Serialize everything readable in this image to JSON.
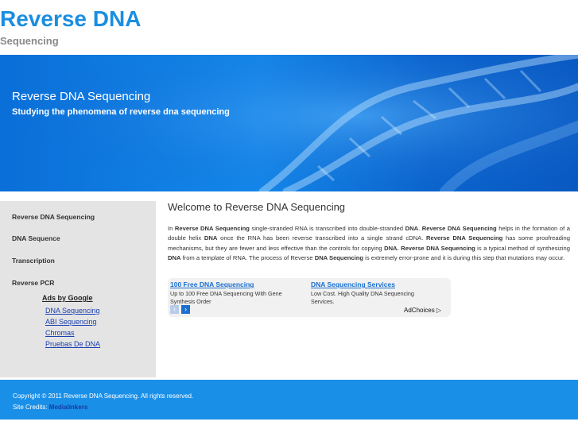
{
  "header": {
    "title": "Reverse DNA",
    "subtitle": "Sequencing"
  },
  "banner": {
    "title": "Reverse DNA Sequencing",
    "subtitle": "Studying the phenomena of reverse dna sequencing"
  },
  "sidebar": {
    "items": [
      {
        "label": "Reverse DNA Sequencing"
      },
      {
        "label": "DNA Sequence"
      },
      {
        "label": "Transcription"
      },
      {
        "label": "Reverse PCR"
      }
    ],
    "ads_title": "Ads by Google",
    "ads": [
      {
        "label": "DNA Sequencing"
      },
      {
        "label": "ABI Sequencing"
      },
      {
        "label": "Chromas"
      },
      {
        "label": "Pruebas De DNA"
      }
    ]
  },
  "main": {
    "title": "Welcome to Reverse DNA Sequencing",
    "paragraph": [
      {
        "text": "In ",
        "bold": false
      },
      {
        "text": "Reverse DNA Sequencing",
        "bold": true
      },
      {
        "text": " single-stranded RNA is transcribed into double-stranded ",
        "bold": false
      },
      {
        "text": "DNA",
        "bold": true
      },
      {
        "text": ".  ",
        "bold": false
      },
      {
        "text": "Reverse DNA Sequencing",
        "bold": true
      },
      {
        "text": " helps in the formation of a double helix ",
        "bold": false
      },
      {
        "text": "DNA",
        "bold": true
      },
      {
        "text": " once the RNA has been reverse transcribed into a single strand cDNA. ",
        "bold": false
      },
      {
        "text": "Reverse DNA Sequencing",
        "bold": true
      },
      {
        "text": " has some proofreading mechanisms, but they are fewer and less effective than the controls for copying ",
        "bold": false
      },
      {
        "text": "DNA. Reverse DNA Sequencing",
        "bold": true
      },
      {
        "text": " is a typical method of synthesizing ",
        "bold": false
      },
      {
        "text": "DNA",
        "bold": true
      },
      {
        "text": " from a template of RNA. The process of Reverse ",
        "bold": false
      },
      {
        "text": "DNA Sequencing",
        "bold": true
      },
      {
        "text": " is extremely error-prone and it is during this step that mutations may occur.",
        "bold": false
      }
    ]
  },
  "adbox": {
    "ads": [
      {
        "title": "100 Free DNA Sequencing",
        "desc": "Up to 100 Free DNA Sequencing With Gene Synthesis Order"
      },
      {
        "title": "DNA Sequencing Services",
        "desc": "Low Cost. High Quality DNA Sequencing Services."
      }
    ],
    "prev": "‹",
    "next": "›",
    "adchoices": "AdChoices ▷"
  },
  "footer": {
    "copyright": "Copyright © 2011 Reverse DNA Sequencing. All rights reserved.",
    "credits_prefix": "Site Credits: ",
    "credits_link": "Medialinkers"
  }
}
